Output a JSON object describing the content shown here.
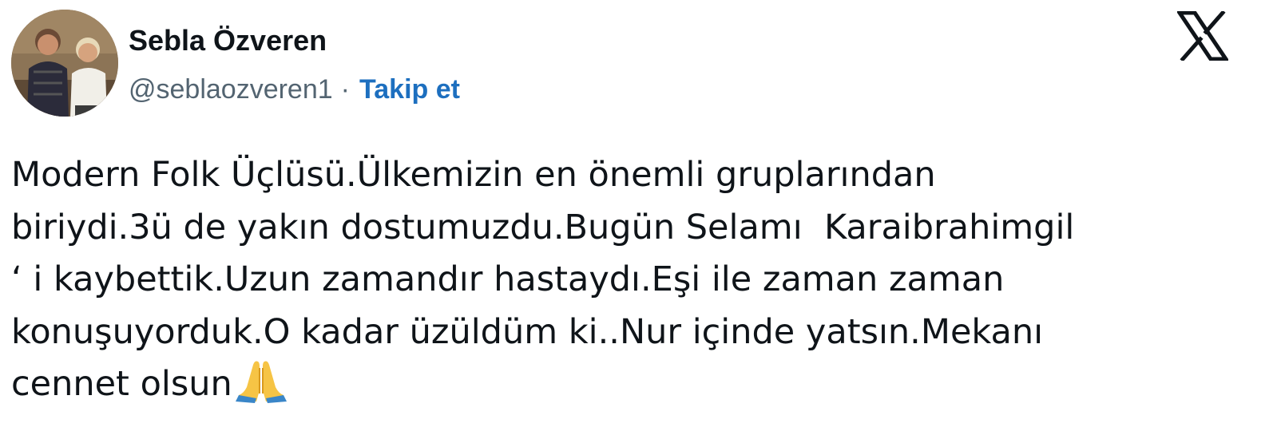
{
  "author": {
    "display_name": "Sebla Özveren",
    "handle": "@seblaozveren1",
    "separator": "·",
    "follow_label": "Takip et",
    "avatar_icon": "profile-photo"
  },
  "platform_icon": "x-logo-icon",
  "tweet": {
    "lines": [
      "Modern Folk Üçlüsü.Ülkemizin en önemli gruplarından",
      "biriydi.3ü de yakın dostumuzdu.Bugün Selamı  Karaibrahimgil",
      "‘ i kaybettik.Uzun zamandır hastaydı.Eşi ile zaman zaman",
      "konuşuyorduk.O kadar üzüldüm ki..Nur içinde yatsın.Mekanı",
      "cennet olsun"
    ],
    "emoji": "folded-hands-icon"
  },
  "colors": {
    "text": "#0f1419",
    "secondary": "#536471",
    "link": "#1d6fbf",
    "background": "#ffffff"
  }
}
